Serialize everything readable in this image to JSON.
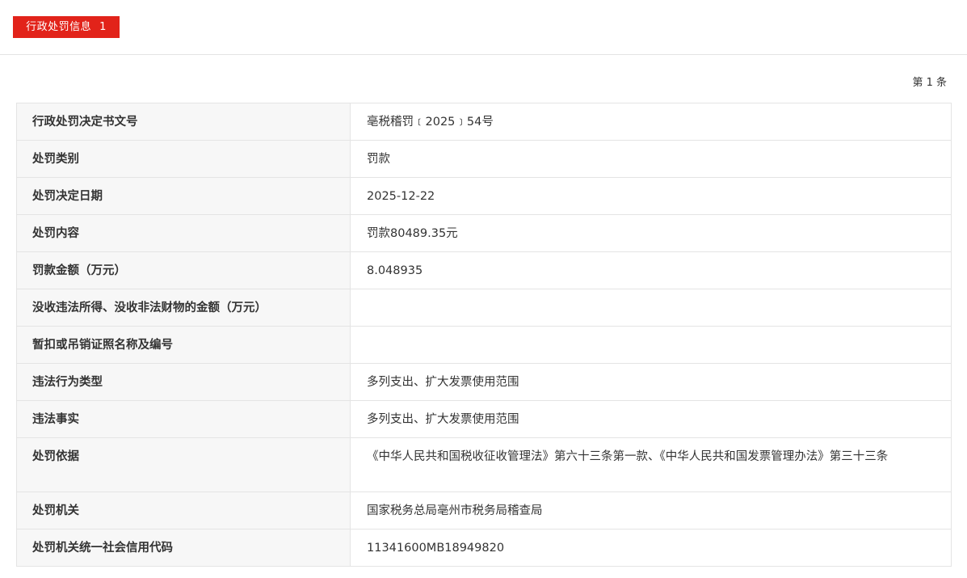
{
  "header": {
    "tab_label": "行政处罚信息",
    "tab_count": "1"
  },
  "record_index": "第 1 条",
  "rows": [
    {
      "label": "行政处罚决定书文号",
      "value": "亳税稽罚﹝2025﹞54号"
    },
    {
      "label": "处罚类别",
      "value": "罚款"
    },
    {
      "label": "处罚决定日期",
      "value": "2025-12-22"
    },
    {
      "label": "处罚内容",
      "value": "罚款80489.35元"
    },
    {
      "label": "罚款金额（万元）",
      "value": "8.048935"
    },
    {
      "label": "没收违法所得、没收非法财物的金额（万元）",
      "value": ""
    },
    {
      "label": "暂扣或吊销证照名称及编号",
      "value": ""
    },
    {
      "label": "违法行为类型",
      "value": "多列支出、扩大发票使用范围"
    },
    {
      "label": "违法事实",
      "value": "多列支出、扩大发票使用范围"
    },
    {
      "label": "处罚依据",
      "value": "《中华人民共和国税收征收管理法》第六十三条第一款、《中华人民共和国发票管理办法》第三十三条"
    },
    {
      "label": "处罚机关",
      "value": "国家税务总局亳州市税务局稽查局"
    },
    {
      "label": "处罚机关统一社会信用代码",
      "value": "11341600MB18949820"
    }
  ],
  "colors": {
    "accent": "#e2231a",
    "label_bg": "#f7f7f7",
    "border": "#e4e4e4",
    "text": "#333333"
  }
}
